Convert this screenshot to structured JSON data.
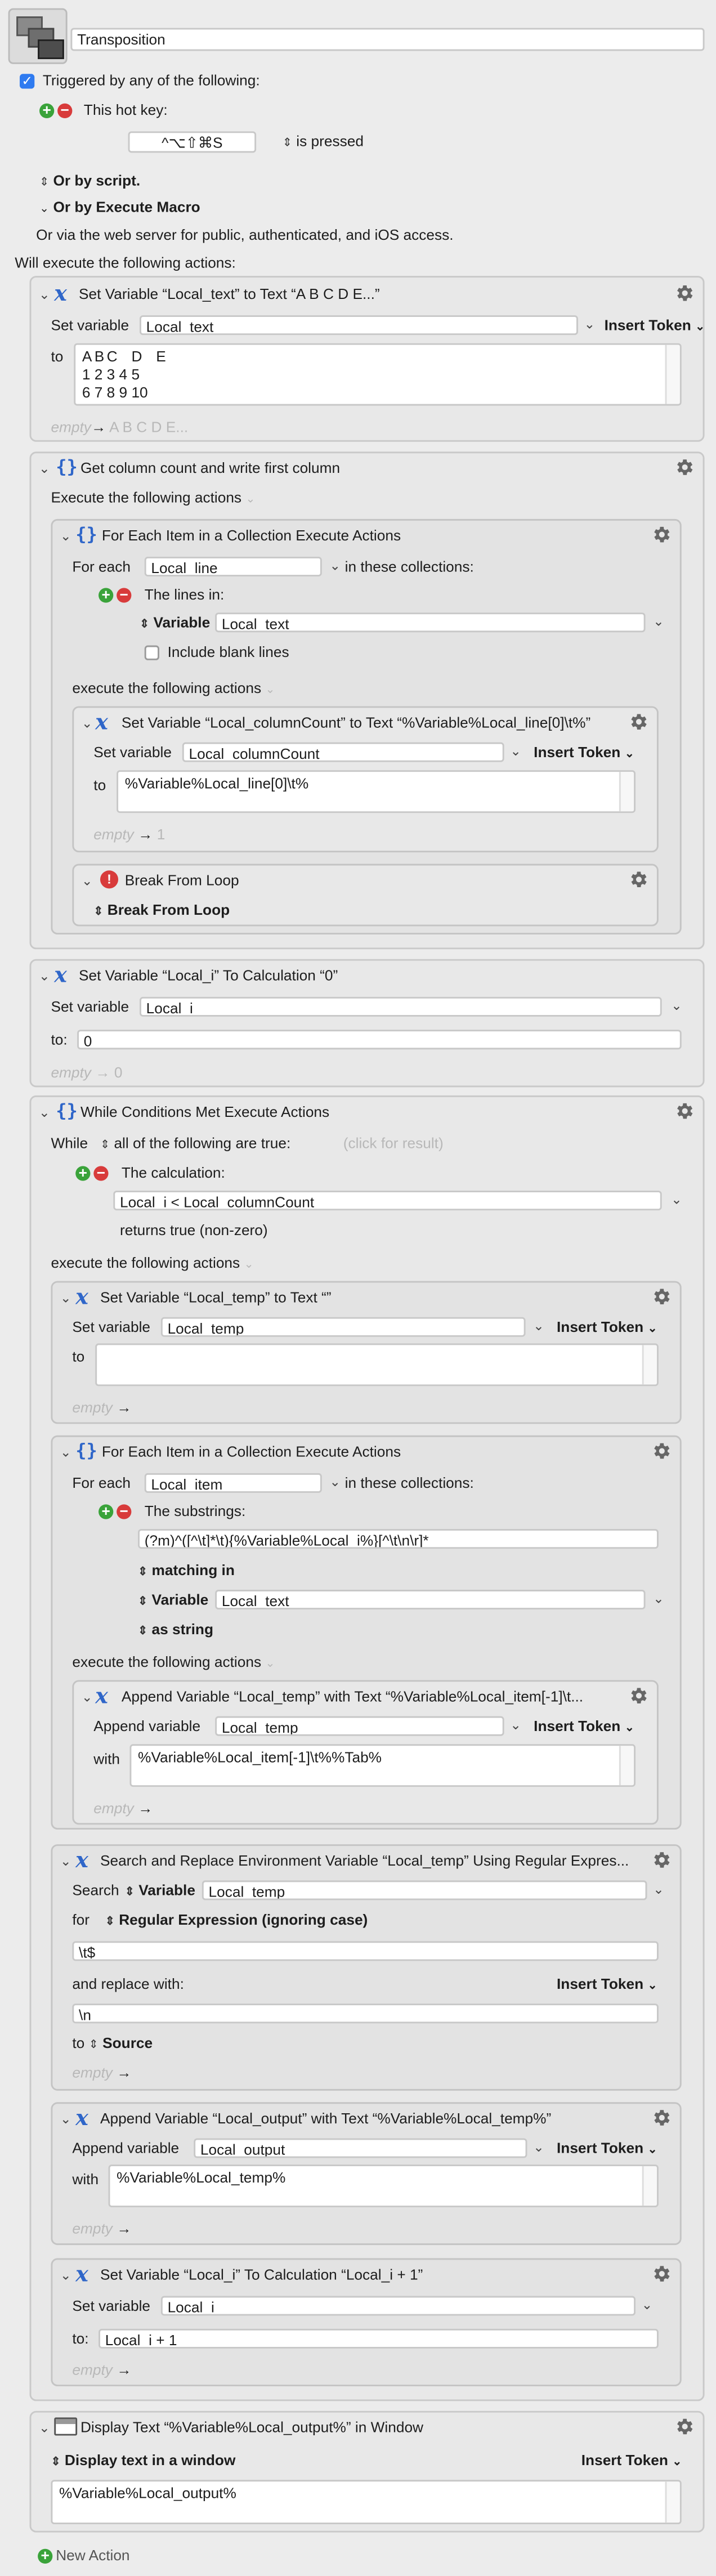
{
  "macro": {
    "name": "Transposition",
    "triggered_label": "Triggered by any of the following:",
    "trigger_checked": true,
    "hotkey_label": "This hot key:",
    "hotkey_value": "^⌥⇧⌘S",
    "hotkey_mode": "is pressed",
    "or_by_script": "Or by script.",
    "or_by_execute": "Or by Execute Macro",
    "web_server": "Or via the web server for public, authenticated, and iOS access.",
    "will_execute": "Will execute the following actions:"
  },
  "common": {
    "set_variable": "Set variable",
    "insert_token": "Insert Token",
    "to": "to",
    "to_colon": "to:",
    "with": "with",
    "append_variable": "Append variable",
    "execute_following": "execute the following actions",
    "for_each": "For each",
    "in_collections": "in these collections:",
    "variable": "Variable",
    "arrow": "→"
  },
  "a1": {
    "title": "Set Variable “Local_text” to Text “A  B  C  D  E...”",
    "var": "Local_text",
    "text": "A\tB\tC\tD\tE\n1\t2\t3\t4\t5\n6\t7\t8\t9\t10",
    "empty": "empty",
    "preview": "A  B  C  D  E..."
  },
  "a2": {
    "title": "Get column count and write first column",
    "exec": "Execute the following actions",
    "fe": {
      "title": "For Each Item in a Collection Execute Actions",
      "var": "Local_line",
      "lines_in": "The lines in:",
      "source": "Local_text",
      "blank": "Include blank lines"
    },
    "sv": {
      "title": "Set Variable “Local_columnCount” to Text “%Variable%Local_line[0]\\t%”",
      "var": "Local_columnCount",
      "text": "%Variable%Local_line[0]\\t%",
      "empty": "empty",
      "preview": "1"
    },
    "brk": {
      "title": "Break From Loop",
      "mode": "Break From Loop"
    }
  },
  "a3": {
    "title": "Set Variable “Local_i” To Calculation “0”",
    "var": "Local_i",
    "value": "0",
    "empty": "empty",
    "preview": "0"
  },
  "a4": {
    "title": "While Conditions Met Execute Actions",
    "while": "While",
    "cond": "all of the following are true:",
    "click": "(click for result)",
    "calc_label": "The calculation:",
    "calc": "Local_i < Local_columnCount",
    "returns": "returns true (non-zero)",
    "st": {
      "title": "Set Variable “Local_temp” to Text “”",
      "var": "Local_temp",
      "empty": "empty"
    },
    "fe": {
      "title": "For Each Item in a Collection Execute Actions",
      "var": "Local_item",
      "substr": "The substrings:",
      "regex": "(?m)^([^\\t]*\\t){%Variable%Local_i%}[^\\t\\n\\r]*",
      "matching": "matching in",
      "source": "Local_text",
      "as_string": "as string",
      "ap": {
        "title": "Append Variable “Local_temp” with Text “%Variable%Local_item[-1]\\t...",
        "var": "Local_temp",
        "text": "%Variable%Local_item[-1]\\t%%Tab%",
        "empty": "empty"
      }
    },
    "sr": {
      "title": "Search and Replace Environment Variable “Local_temp” Using Regular Expres...",
      "search": "Search",
      "var": "Local_temp",
      "for": "for",
      "mode": "Regular Expression (ignoring case)",
      "pattern": "\\t$",
      "replace_label": "and replace with:",
      "replacement": "\\n",
      "to_label": "to",
      "dest": "Source",
      "empty": "empty"
    },
    "ao": {
      "title": "Append Variable “Local_output” with Text “%Variable%Local_temp%”",
      "var": "Local_output",
      "text": "%Variable%Local_temp%",
      "empty": "empty"
    },
    "inc": {
      "title": "Set Variable “Local_i” To Calculation “Local_i + 1”",
      "var": "Local_i",
      "value": "Local_i + 1",
      "empty": "empty"
    }
  },
  "a5": {
    "title": "Display Text “%Variable%Local_output%” in Window",
    "mode": "Display text in a window",
    "text": "%Variable%Local_output%"
  },
  "new_action": "New Action",
  "colors": {
    "accent": "#2f66c9",
    "add": "#3aa33a",
    "remove": "#d83b3b",
    "checkbox": "#2f7bf0"
  }
}
